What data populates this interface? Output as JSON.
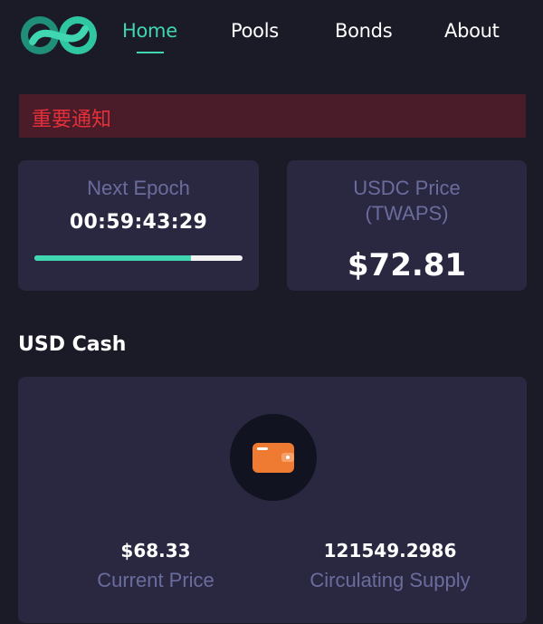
{
  "nav": {
    "items": [
      {
        "label": "Home",
        "active": true
      },
      {
        "label": "Pools",
        "active": false
      },
      {
        "label": "Bonds",
        "active": false
      },
      {
        "label": "About",
        "active": false
      }
    ]
  },
  "notice": {
    "text": "重要通知"
  },
  "epoch": {
    "label": "Next Epoch",
    "countdown": "00:59:43:29",
    "progress_percent": 75
  },
  "price": {
    "label": "USDC Price (TWAPS)",
    "value": "$72.81"
  },
  "cash": {
    "title": "USD Cash",
    "current_price_value": "$68.33",
    "current_price_label": "Current Price",
    "supply_value": "121549.2986",
    "supply_label": "Circulating Supply"
  },
  "colors": {
    "accent": "#3fd6b1",
    "background": "#1b1a27",
    "card": "#2a2840",
    "notice_bg": "#4a1c2a",
    "notice_text": "#e5303a",
    "muted_text": "#6b6c9e",
    "wallet_orange": "#ef7a32"
  },
  "icons": {
    "logo": "infinity-logo-icon",
    "wallet": "wallet-icon"
  }
}
